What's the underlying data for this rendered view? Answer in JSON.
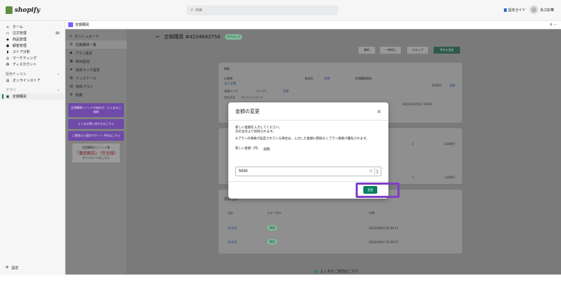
{
  "topbar": {
    "logo_text": "shopify",
    "search_placeholder": "検索",
    "setup_guide": "設定ガイド",
    "user_name": "永江彩華"
  },
  "sidebar": {
    "items": [
      {
        "label": "ホーム",
        "icon": "home-icon"
      },
      {
        "label": "注文管理",
        "icon": "orders-icon",
        "badge": "39"
      },
      {
        "label": "商品管理",
        "icon": "tag-icon"
      },
      {
        "label": "顧客管理",
        "icon": "person-icon"
      },
      {
        "label": "ストア分析",
        "icon": "bar-chart-icon"
      },
      {
        "label": "マーケティング",
        "icon": "target-icon"
      },
      {
        "label": "ディスカウント",
        "icon": "discount-icon"
      }
    ],
    "sales_channel_label": "販売チャネル",
    "online_store": "オンラインストア",
    "apps_label": "アプリ",
    "active_app": "定期購買",
    "settings": "設定"
  },
  "app": {
    "title": "定期購買",
    "nav": [
      {
        "label": "ダッシュボード"
      },
      {
        "label": "定期購買一覧"
      },
      {
        "label": "プラン設定"
      },
      {
        "label": "BOX設定"
      },
      {
        "label": "会員ランク設定"
      },
      {
        "label": "インストール"
      },
      {
        "label": "有料プラン"
      },
      {
        "label": "初期"
      }
    ],
    "promos": [
      "定期購買メソッドの始め方・よくあるご質問",
      "よくある問い合わせはこちら",
      "ご質問なら個別サポート 予約はこちら"
    ],
    "book_promo": {
      "line1": "定期購買のメソッド集",
      "line2": "『徹底解説』（完全版）",
      "line3": "ダウンロードはこちら"
    },
    "page_title": "定期購買 #4104683754",
    "status": "アクティブ",
    "actions": [
      "解約",
      "一時停止",
      "スキップ",
      "今すぐ注文"
    ],
    "bg_labels": {
      "order_section": "概要",
      "customer": "お客様",
      "customer_name": "永江 彩華",
      "member_rank": "会員ランク",
      "rank_value": "ランク1",
      "payment": "支払方法",
      "payment_value": "クレジットカード",
      "shipping": "配送先",
      "next_info": "定期購買情報",
      "date": "2022年10月1日 19:00",
      "amount": "1200円",
      "edit": "変更"
    },
    "history_title": "定期注文",
    "history_headers": [
      "注文",
      "ステータス",
      "日時"
    ],
    "history_rows": [
      {
        "id": "#1023",
        "status": "発送",
        "date": "2022/09/20 01:40:11"
      },
      {
        "id": "#1020",
        "status": "発送",
        "date": "2022/09/27 16:39:27"
      }
    ],
    "table_values": [
      "1",
      "4,000円",
      "1",
      "1,000円"
    ]
  },
  "modal": {
    "title": "金額の変更",
    "desc_line1": "新しい金額を入力してください。",
    "desc_line2": "次の注文より反映されます。",
    "desc_line3": "※プランの価格が設定されている場合は、入力した金額に関係なくプラン価格が優先されます。",
    "field_label": "新しい金額（円）",
    "field_tag": "必須",
    "field_value": "5000",
    "unit": "円",
    "submit": "変更"
  },
  "help": "よくあるご質問はこちら"
}
